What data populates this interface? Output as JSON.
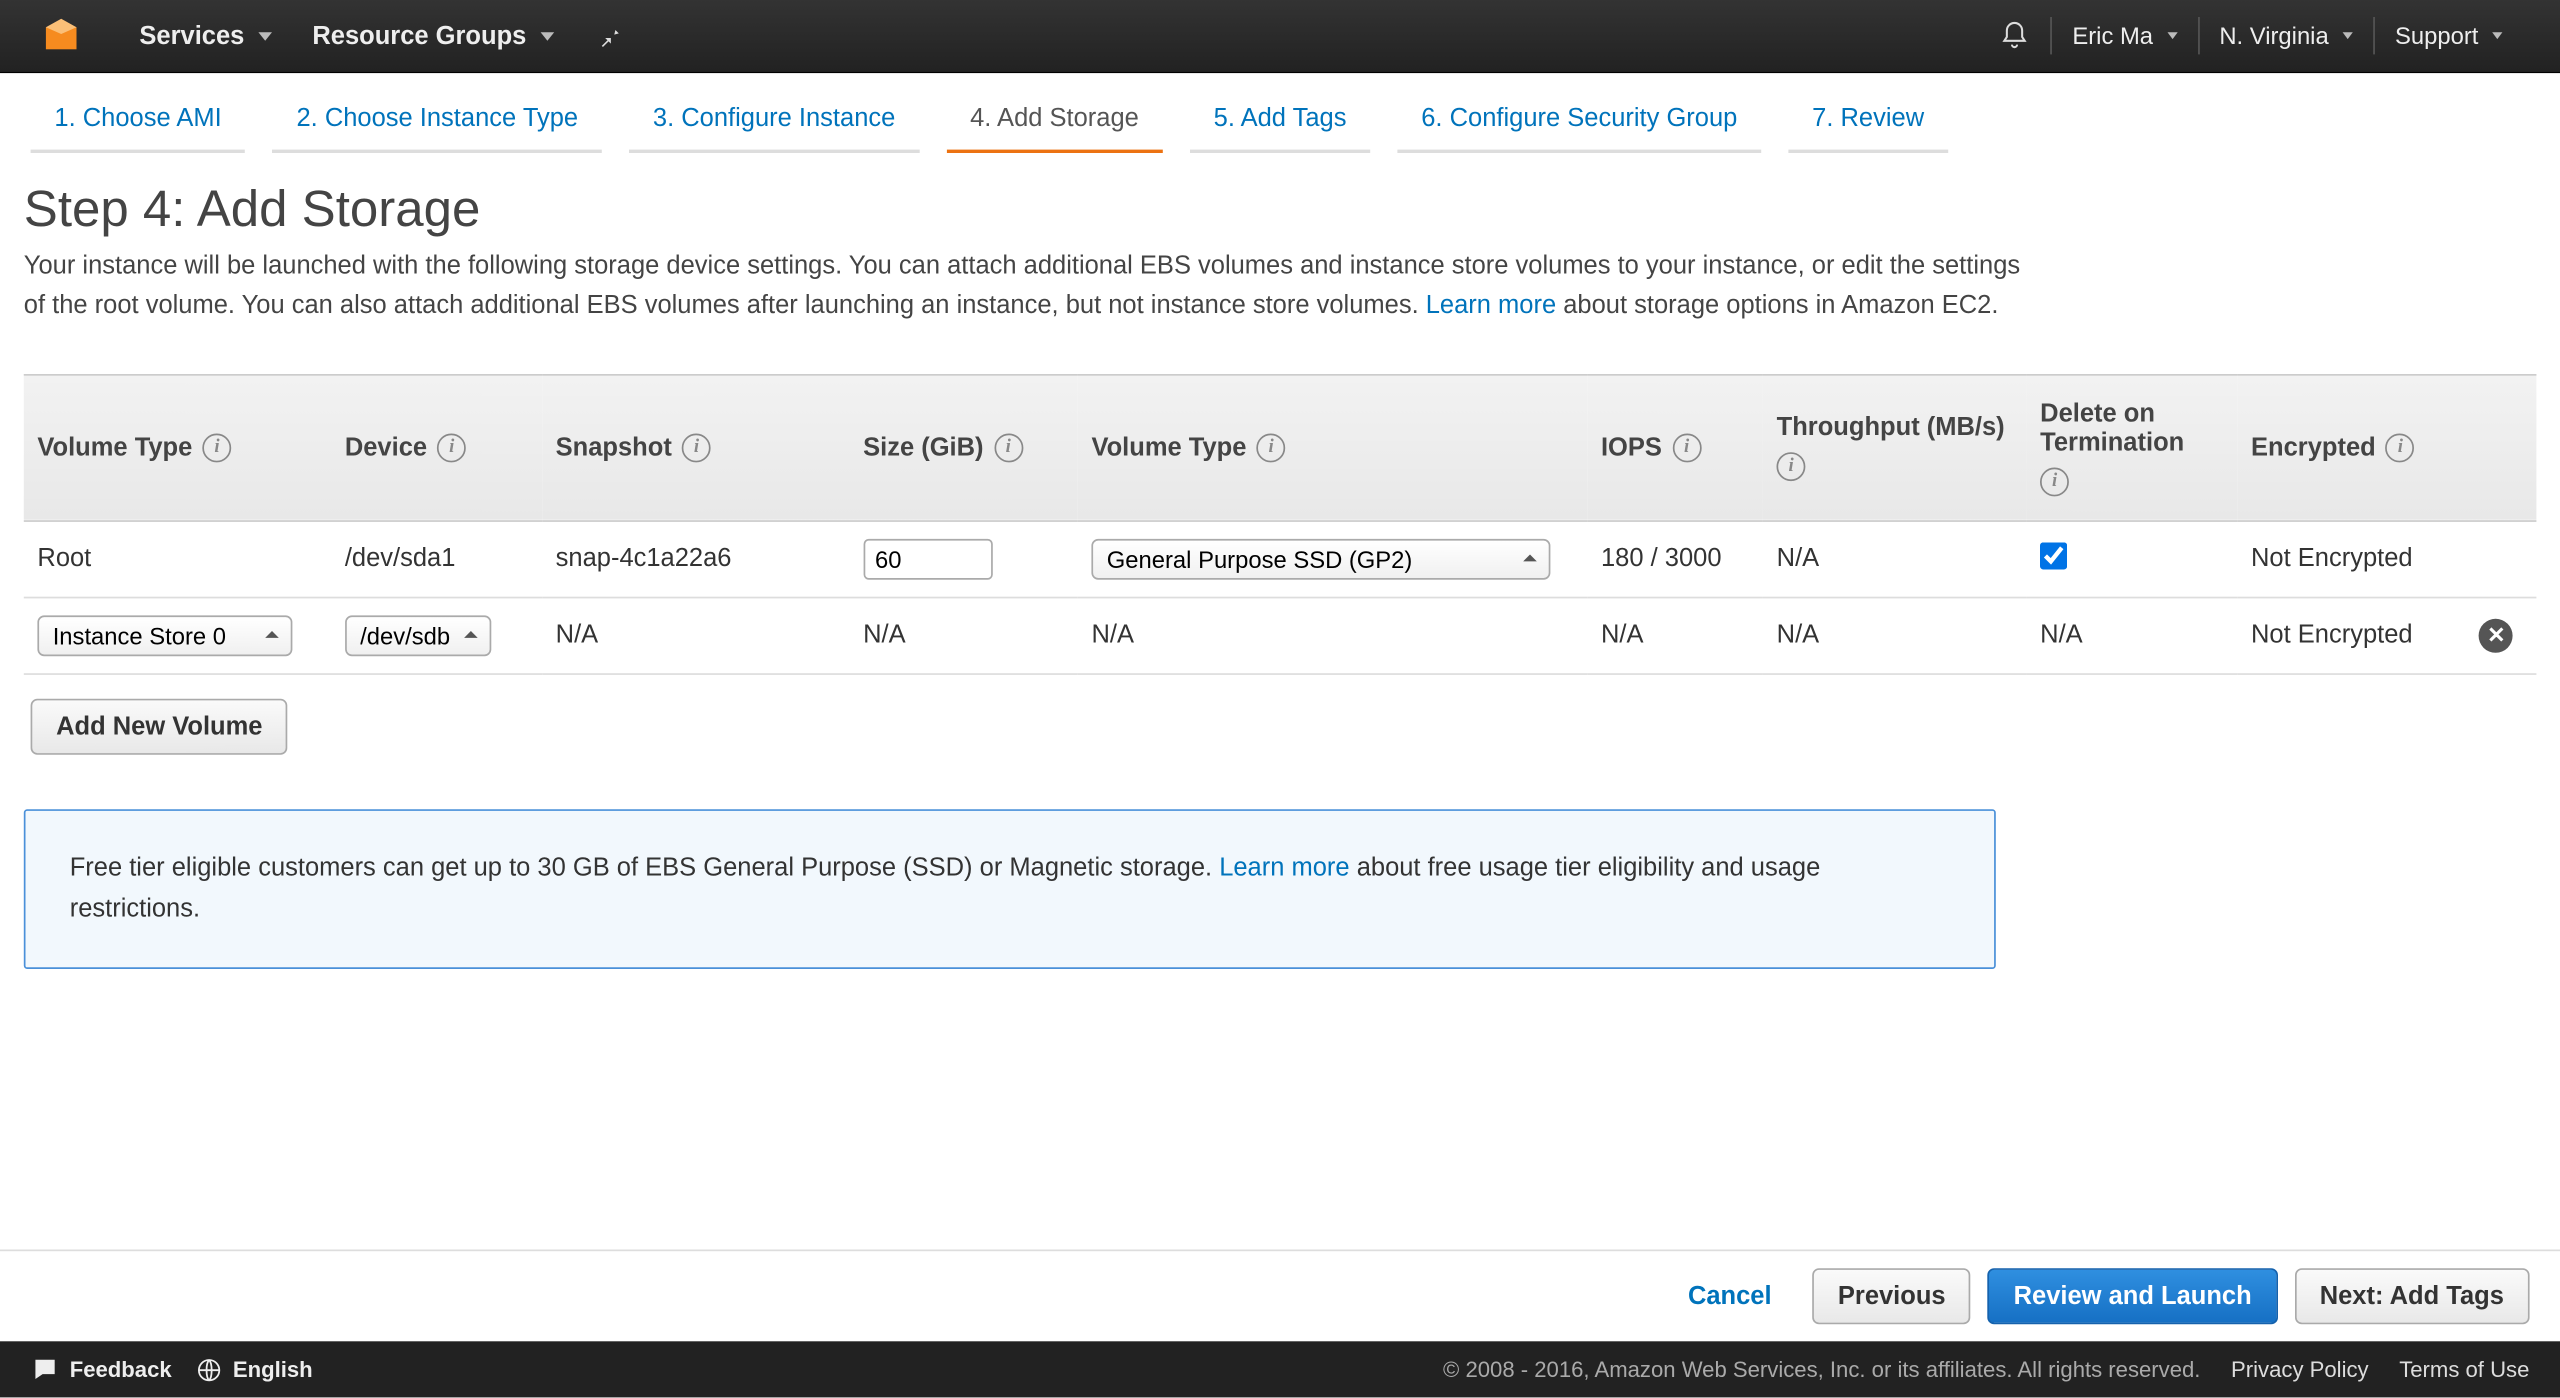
{
  "topnav": {
    "services": "Services",
    "resource_groups": "Resource Groups",
    "user": "Eric Ma",
    "region": "N. Virginia",
    "support": "Support"
  },
  "wizard": {
    "steps": [
      "1. Choose AMI",
      "2. Choose Instance Type",
      "3. Configure Instance",
      "4. Add Storage",
      "5. Add Tags",
      "6. Configure Security Group",
      "7. Review"
    ],
    "active_index": 3
  },
  "page": {
    "title": "Step 4: Add Storage",
    "desc_1": "Your instance will be launched with the following storage device settings. You can attach additional EBS volumes and instance store volumes to your instance, or edit the settings of the root volume. You can also attach additional EBS volumes after launching an instance, but not instance store volumes. ",
    "learn_more": "Learn more",
    "desc_2": " about storage options in Amazon EC2."
  },
  "table": {
    "headers": {
      "volume_type_col": "Volume Type",
      "device": "Device",
      "snapshot": "Snapshot",
      "size": "Size (GiB)",
      "volume_type2": "Volume Type",
      "iops": "IOPS",
      "throughput": "Throughput (MB/s)",
      "delete_on_term": "Delete on Termination",
      "encrypted": "Encrypted"
    },
    "rows": [
      {
        "type_label": "Root",
        "device": "/dev/sda1",
        "snapshot": "snap-4c1a22a6",
        "size": "60",
        "vol_type_selected": "General Purpose SSD (GP2)",
        "iops": "180 / 3000",
        "throughput": "N/A",
        "delete_on_term": true,
        "encrypted": "Not Encrypted",
        "removable": false,
        "editable_type": false,
        "editable_device": false,
        "editable_size": true,
        "editable_voltype": true
      },
      {
        "type_label": "Instance Store 0",
        "device": "/dev/sdb",
        "snapshot": "N/A",
        "size": "N/A",
        "vol_type_selected": "N/A",
        "iops": "N/A",
        "throughput": "N/A",
        "delete_on_term_text": "N/A",
        "encrypted": "Not Encrypted",
        "removable": true,
        "editable_type": true,
        "editable_device": true,
        "editable_size": false,
        "editable_voltype": false
      }
    ],
    "add_new": "Add New Volume"
  },
  "info_box": {
    "text_1": "Free tier eligible customers can get up to 30 GB of EBS General Purpose (SSD) or Magnetic storage. ",
    "link": "Learn more",
    "text_2": " about free usage tier eligibility and usage restrictions."
  },
  "actions": {
    "cancel": "Cancel",
    "previous": "Previous",
    "review_launch": "Review and Launch",
    "next": "Next: Add Tags"
  },
  "footer": {
    "feedback": "Feedback",
    "language": "English",
    "copyright": "© 2008 - 2016, Amazon Web Services, Inc. or its affiliates. All rights reserved.",
    "privacy": "Privacy Policy",
    "terms": "Terms of Use"
  }
}
